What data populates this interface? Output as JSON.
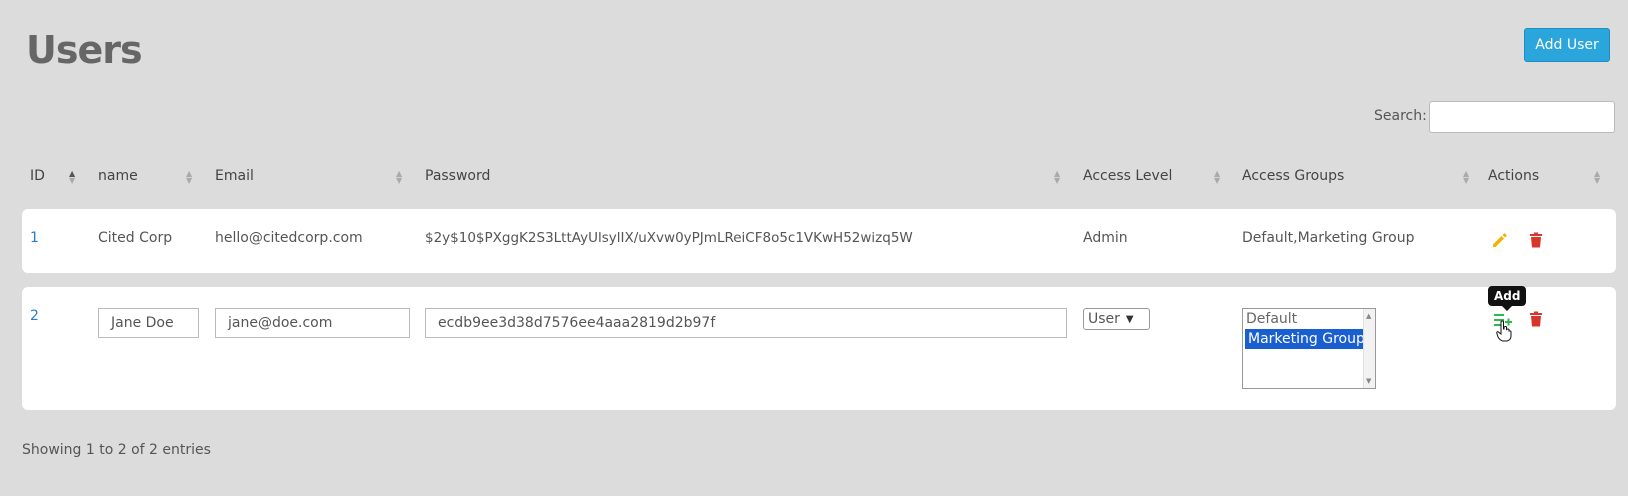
{
  "page": {
    "title": "Users"
  },
  "toolbar": {
    "add_user_label": "Add User"
  },
  "search": {
    "label": "Search:",
    "value": ""
  },
  "table": {
    "columns": [
      "ID",
      "name",
      "Email",
      "Password",
      "Access Level",
      "Access Groups",
      "Actions"
    ],
    "rows": [
      {
        "id": "1",
        "name": "Cited Corp",
        "email": "hello@citedcorp.com",
        "password": "$2y$10$PXggK2S3LttAyUlsylIX/uXvw0yPJmLReiCF8o5c1VKwH52wizq5W",
        "access_level": "Admin",
        "access_groups": "Default,Marketing Group"
      },
      {
        "id": "2",
        "name": "Jane Doe",
        "email": "jane@doe.com",
        "password": "ecdb9ee3d38d7576ee4aaa2819d2b97f",
        "access_level": "User",
        "access_group_options": [
          "Default",
          "Marketing Group"
        ],
        "access_group_selected": "Marketing Group"
      }
    ]
  },
  "tooltip": {
    "text": "Add"
  },
  "footer": {
    "info": "Showing 1 to 2 of 2 entries"
  },
  "colors": {
    "accent": "#2aa6dc",
    "edit": "#f0b400",
    "delete": "#d9362b",
    "add": "#2db84b",
    "link": "#2a7cd1",
    "selected": "#1a5fd1"
  },
  "icons": [
    "pencil-icon",
    "trash-icon",
    "add-list-icon",
    "hand-cursor-icon",
    "sort-icon"
  ]
}
